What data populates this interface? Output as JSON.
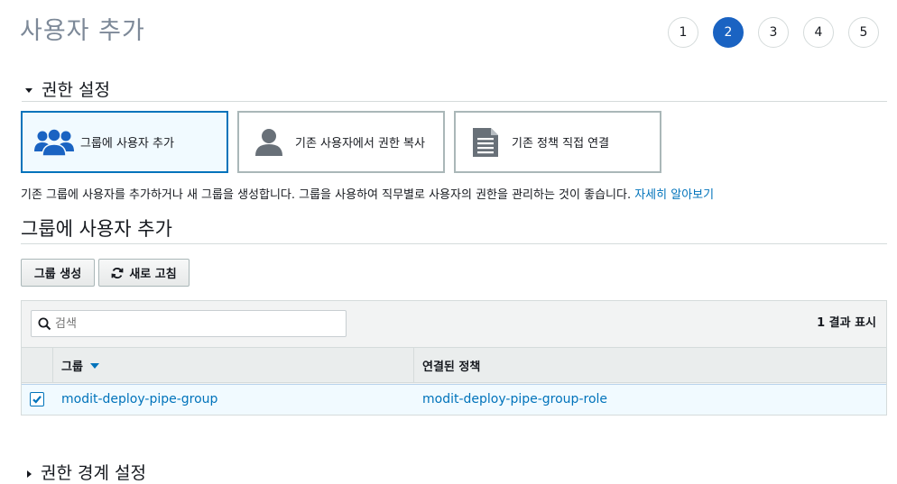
{
  "page": {
    "title": "사용자 추가"
  },
  "steps": [
    "1",
    "2",
    "3",
    "4",
    "5"
  ],
  "current_step": "2",
  "permissions": {
    "section_title": "권한 설정",
    "options": [
      {
        "label": "그룹에 사용자 추가",
        "icon": "users-group-icon",
        "selected": true
      },
      {
        "label": "기존 사용자에서 권한 복사",
        "icon": "user-icon",
        "selected": false
      },
      {
        "label": "기존 정책 직접 연결",
        "icon": "document-icon",
        "selected": false
      }
    ],
    "description": "기존 그룹에 사용자를 추가하거나 새 그룹을 생성합니다. 그룹을 사용하여 직무별로 사용자의 권한을 관리하는 것이 좋습니다.",
    "learn_more": "자세히 알아보기"
  },
  "group_section": {
    "title": "그룹에 사용자 추가",
    "create_button": "그룹 생성",
    "refresh_button": "새로 고침",
    "search_placeholder": "검색",
    "result_count": "1 결과 표시",
    "columns": {
      "group": "그룹",
      "policy": "연결된 정책"
    },
    "rows": [
      {
        "group": "modit-deploy-pipe-group",
        "policy": "modit-deploy-pipe-group-role",
        "checked": true
      }
    ]
  },
  "boundary": {
    "section_title": "권한 경계 설정"
  },
  "colors": {
    "accent": "#0073bb",
    "step_active": "#1a63c2",
    "selected_bg": "#f1faff"
  }
}
